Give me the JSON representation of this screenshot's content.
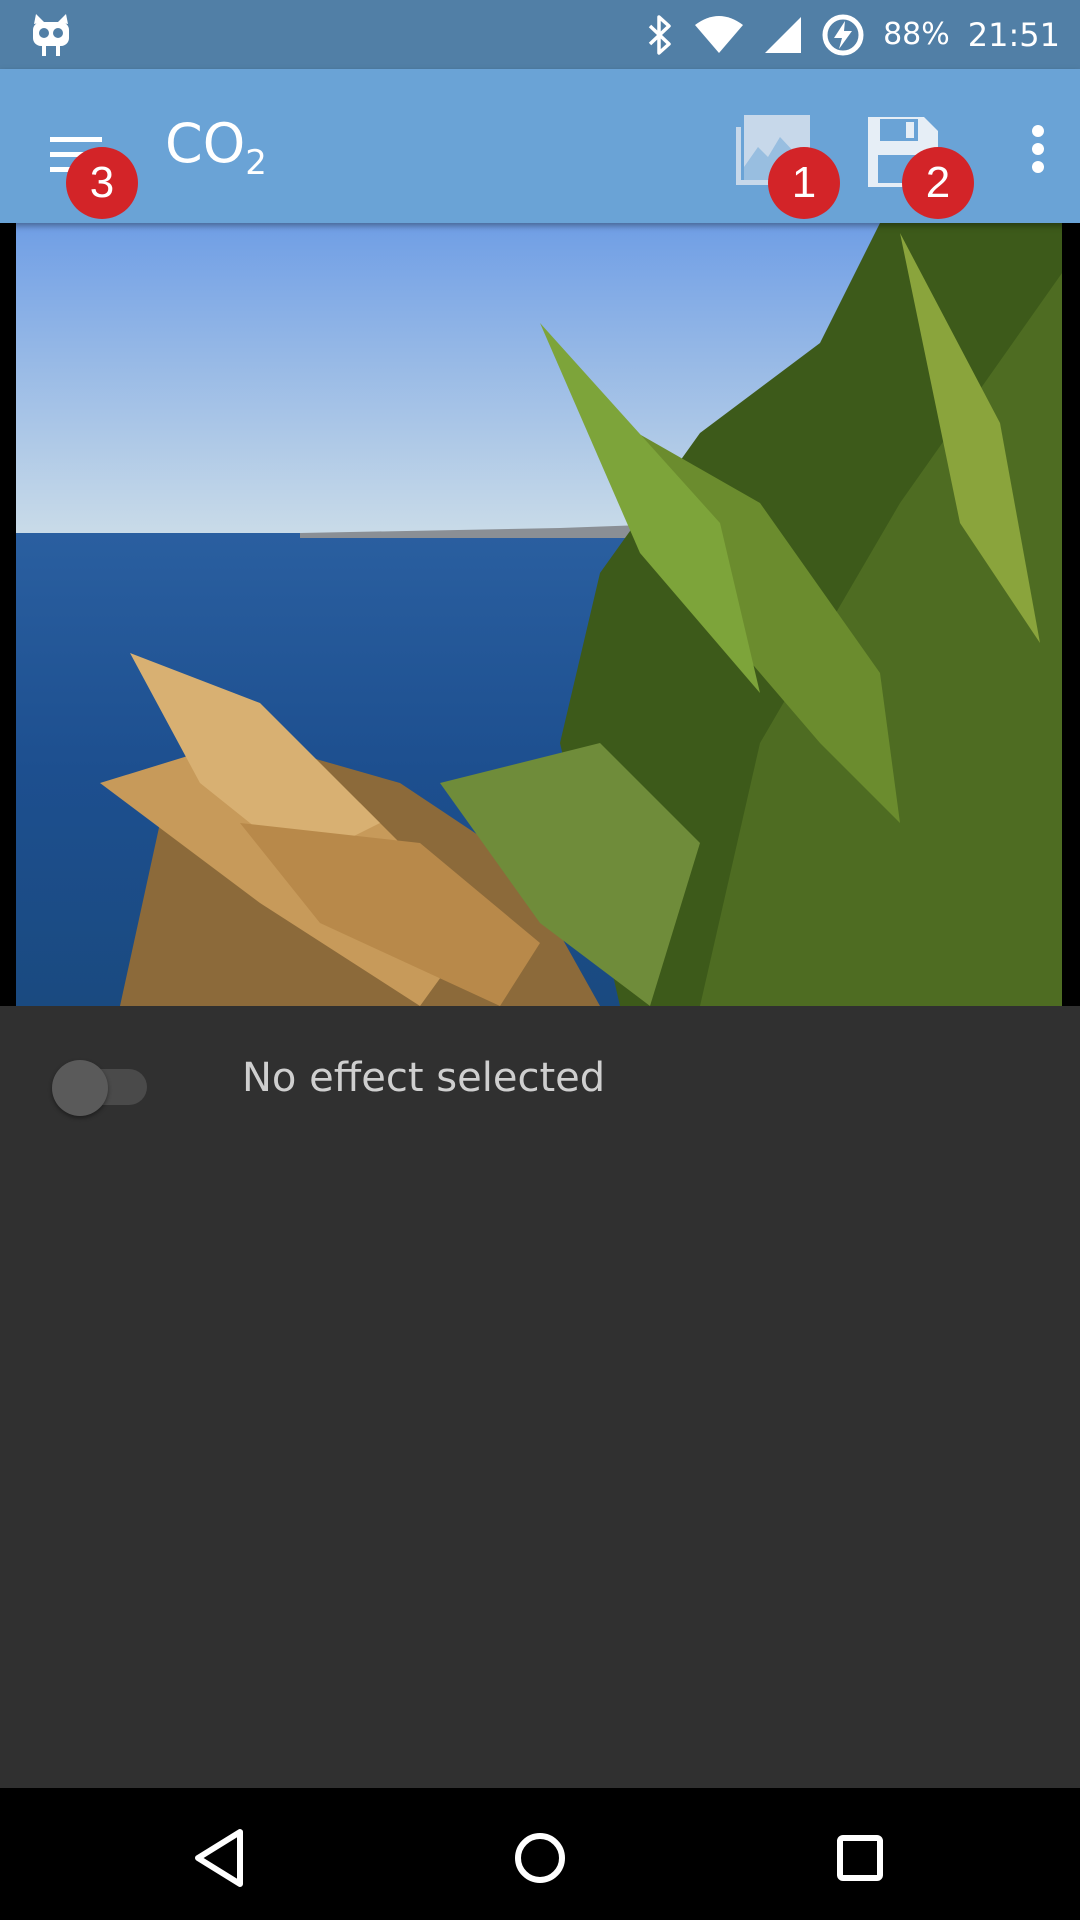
{
  "status_bar": {
    "battery_percent": "88%",
    "time": "21:51",
    "icons": [
      "cyanogen-mascot-icon",
      "bluetooth-icon",
      "wifi-icon",
      "cell-signal-icon",
      "battery-charging-icon"
    ]
  },
  "app_bar": {
    "title_main": "CO",
    "title_sub": "2",
    "actions": [
      "crop-compare-icon",
      "save-icon",
      "more-vert-icon"
    ],
    "badges": [
      "3",
      "1",
      "2"
    ]
  },
  "effect": {
    "toggle_on": false,
    "label": "No effect selected"
  },
  "nav_bar": {
    "buttons": [
      "back-icon",
      "home-icon",
      "recents-icon"
    ]
  },
  "colors": {
    "status_bar": "#517fa6",
    "app_bar": "#6aa3d6",
    "badge": "#d32428",
    "background": "#303030"
  }
}
